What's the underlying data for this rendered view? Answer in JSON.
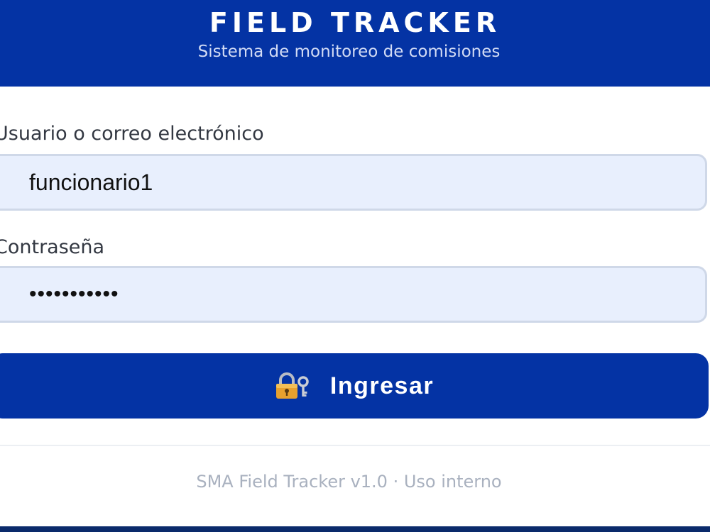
{
  "header": {
    "title": "FIELD TRACKER",
    "subtitle": "Sistema de monitoreo de comisiones"
  },
  "form": {
    "user_label": "Usuario o correo electrónico",
    "user_value": "funcionario1",
    "password_label": "Contraseña",
    "password_value": "•••••••••••",
    "submit_label": "Ingresar",
    "submit_icon": "lock-with-key-icon"
  },
  "footer": {
    "text": "SMA Field Tracker v1.0 · Uso interno"
  },
  "colors": {
    "brand_blue": "#0433a4",
    "input_bg": "#e8effd",
    "input_border": "#cfd8e8",
    "footer_text": "#a9b1bf"
  }
}
